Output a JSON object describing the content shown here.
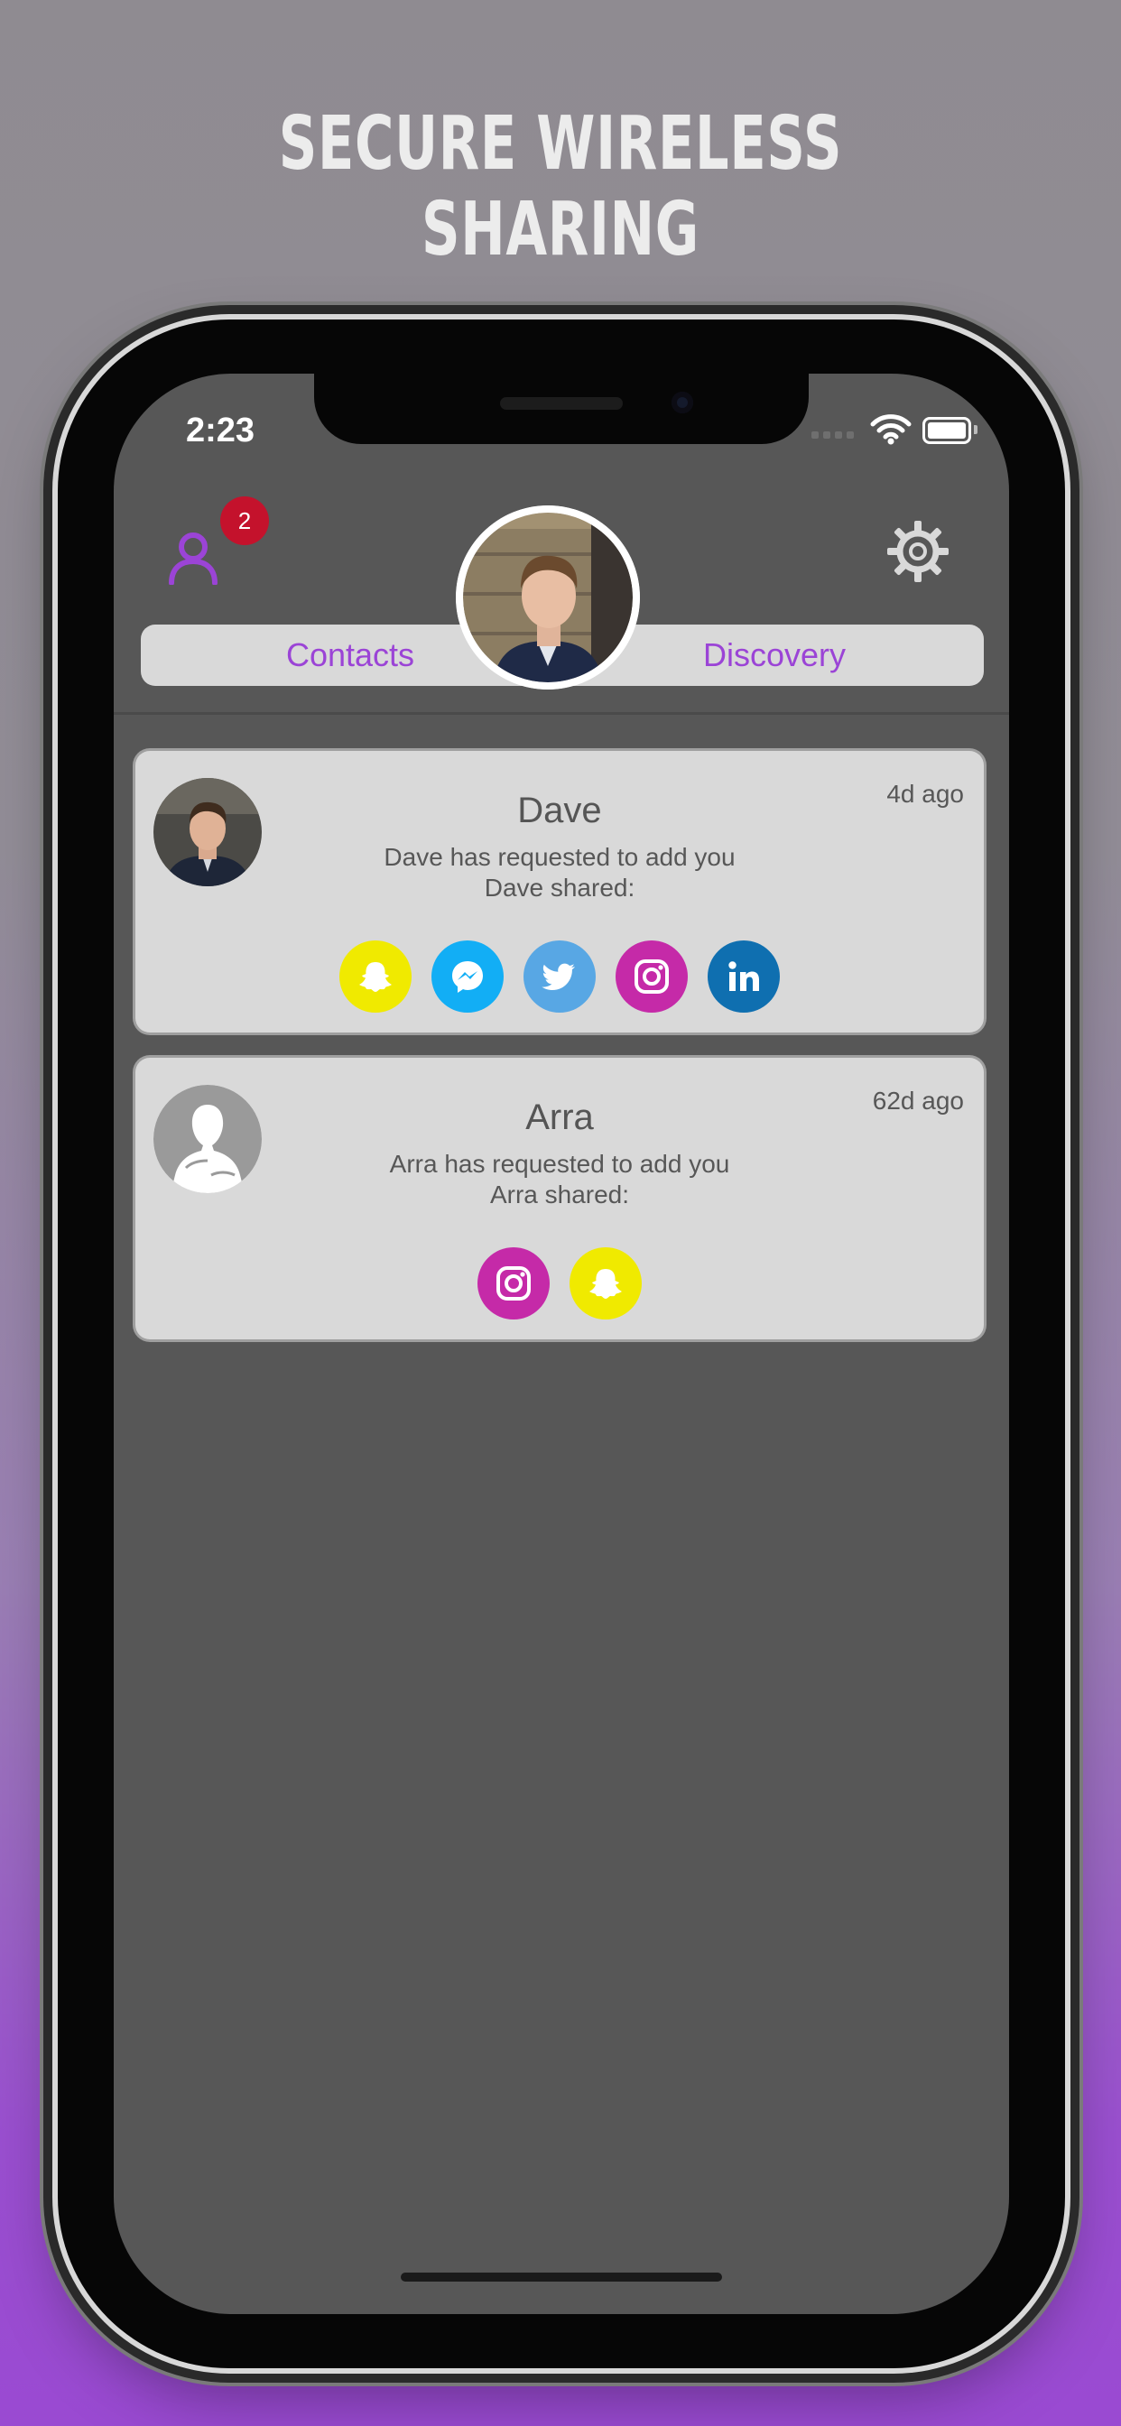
{
  "headline": "SECURE WIRELESS SHARING",
  "status_bar": {
    "time": "2:23"
  },
  "header": {
    "badge_count": "2",
    "tabs": [
      {
        "label": "Contacts"
      },
      {
        "label": "Discovery"
      }
    ]
  },
  "requests": [
    {
      "name": "Dave",
      "time": "4d ago",
      "message": "Dave has requested to add you",
      "shared_label": "Dave shared:",
      "networks": [
        "snapchat-icon",
        "messenger-icon",
        "twitter-icon",
        "instagram-icon",
        "linkedin-icon"
      ]
    },
    {
      "name": "Arra",
      "time": "62d ago",
      "message": "Arra has requested to add you",
      "shared_label": "Arra shared:",
      "networks": [
        "instagram-icon",
        "snapchat-icon"
      ]
    }
  ],
  "colors": {
    "accent": "#9b44d6",
    "badge": "#c4122c",
    "snapchat": "#f0ea00",
    "messenger": "#12aef5",
    "twitter": "#58a7e4",
    "instagram": "#c52aa8",
    "linkedin": "#0f6fb0"
  }
}
